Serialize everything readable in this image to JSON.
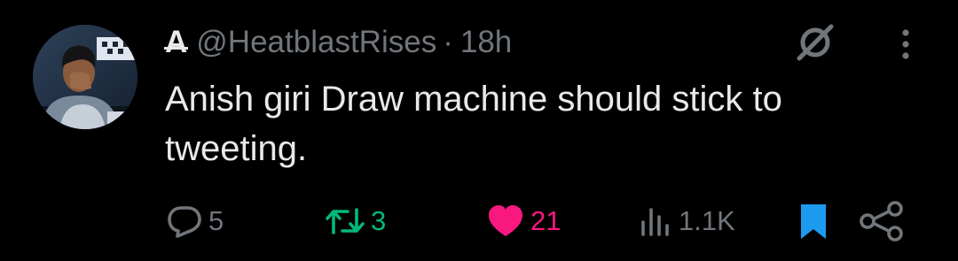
{
  "author": {
    "display_name": "A",
    "handle": "@HeatblastRises",
    "separator": "·",
    "time": "18h"
  },
  "tweet": {
    "text": "Anish giri Draw machine should stick to tweeting."
  },
  "actions": {
    "replies": "5",
    "reposts": "3",
    "likes": "21",
    "views": "1.1K"
  },
  "state": {
    "liked": true,
    "reposted": true,
    "bookmarked": true
  },
  "icons": {
    "grok": "grok-icon",
    "more": "more-icon",
    "reply": "reply-icon",
    "repost": "repost-icon",
    "like": "heart-icon",
    "views": "views-icon",
    "bookmark": "bookmark-icon",
    "share": "share-icon"
  },
  "colors": {
    "background": "#000000",
    "text_primary": "#e7e9ea",
    "text_secondary": "#71767b",
    "repost_active": "#00ba7c",
    "like_active": "#f91880",
    "bookmark_active": "#1d9bf0"
  }
}
